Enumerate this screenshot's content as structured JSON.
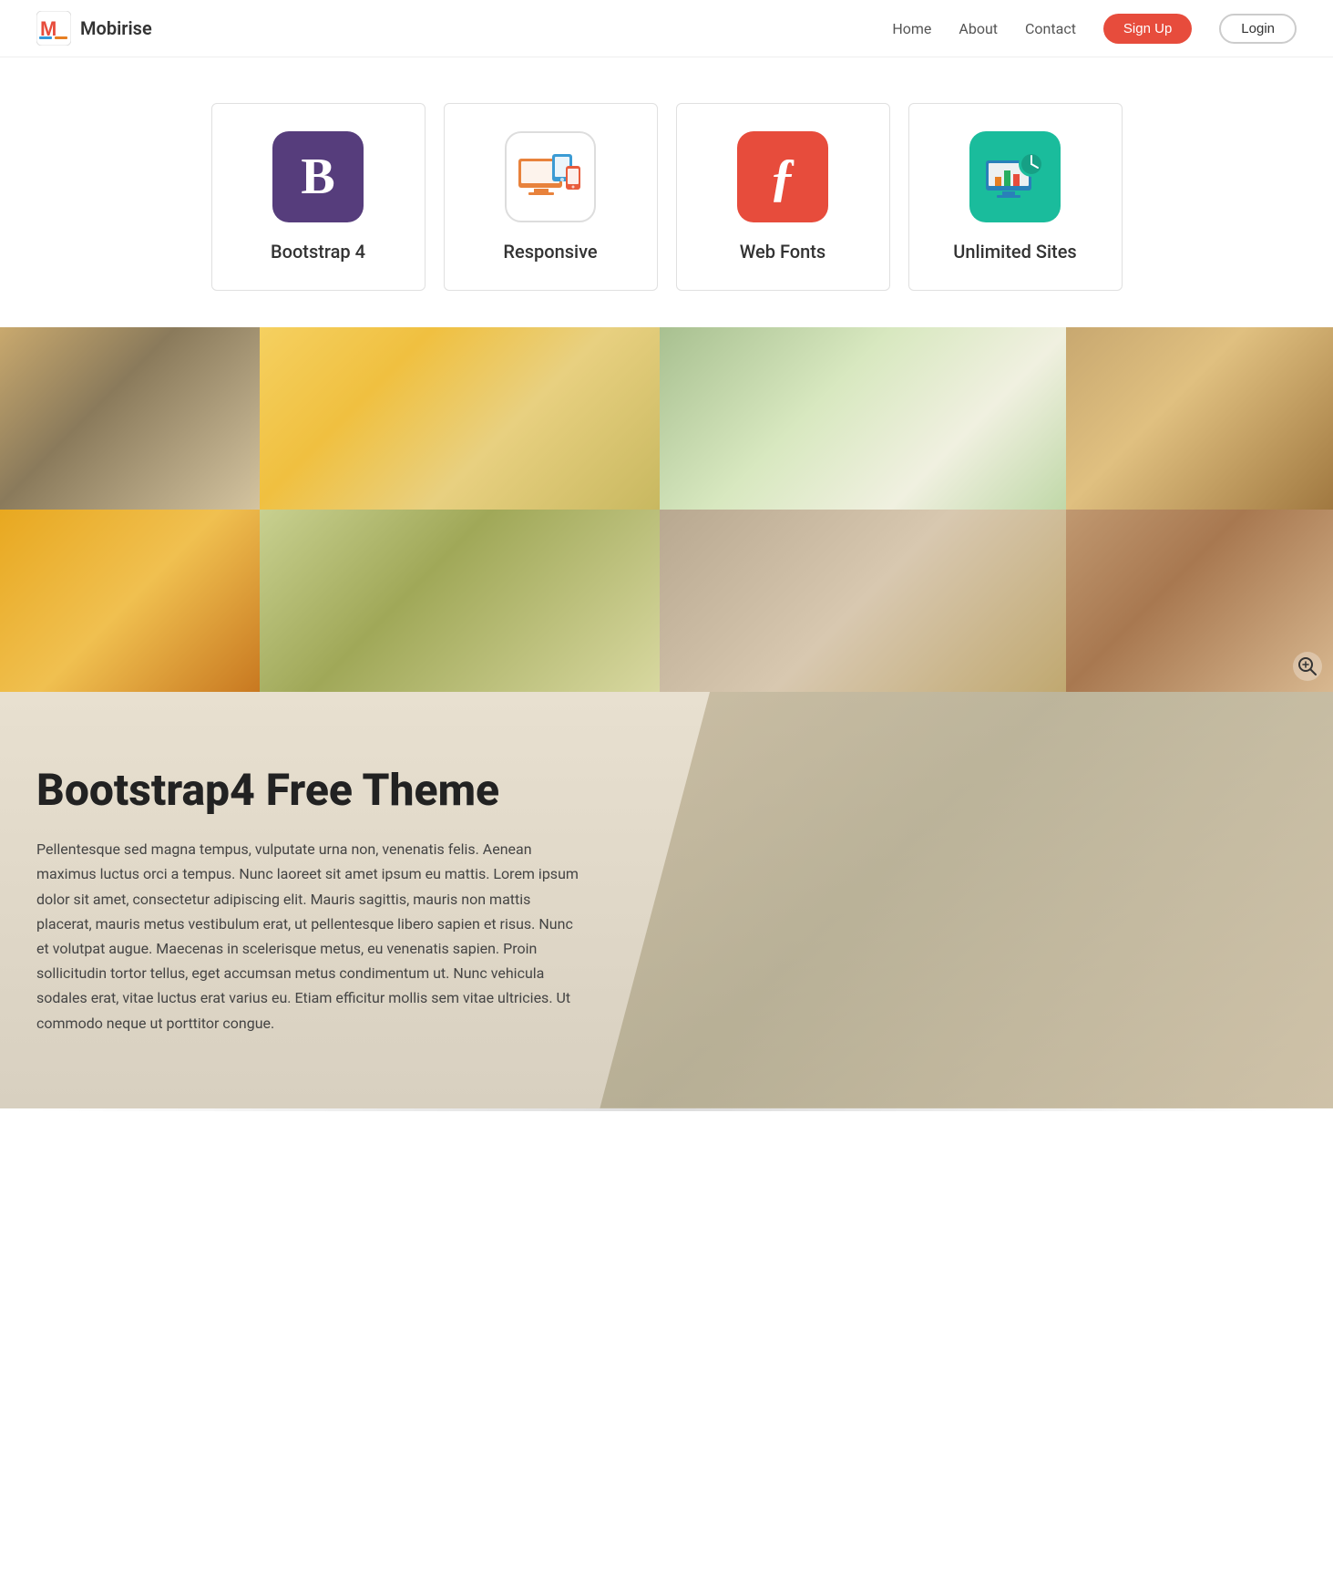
{
  "brand": {
    "name": "Mobirise"
  },
  "navbar": {
    "links": [
      {
        "id": "home",
        "label": "Home"
      },
      {
        "id": "about",
        "label": "About"
      },
      {
        "id": "contact",
        "label": "Contact"
      }
    ],
    "signup_label": "Sign Up",
    "login_label": "Login"
  },
  "features": [
    {
      "id": "bootstrap4",
      "title": "Bootstrap 4",
      "icon_type": "bootstrap"
    },
    {
      "id": "responsive",
      "title": "Responsive",
      "icon_type": "responsive"
    },
    {
      "id": "webfonts",
      "title": "Web Fonts",
      "icon_type": "fonts"
    },
    {
      "id": "unlimited",
      "title": "Unlimited Sites",
      "icon_type": "unlimited"
    }
  ],
  "content": {
    "title": "Bootstrap4 Free Theme",
    "body": "Pellentesque sed magna tempus, vulputate urna non, venenatis felis. Aenean maximus luctus orci a tempus. Nunc laoreet sit amet ipsum eu mattis. Lorem ipsum dolor sit amet, consectetur adipiscing elit. Mauris sagittis, mauris non mattis placerat, mauris metus vestibulum erat, ut pellentesque libero sapien et risus. Nunc et volutpat augue. Maecenas in scelerisque metus, eu venenatis sapien. Proin sollicitudin tortor tellus, eget accumsan metus condimentum ut. Nunc vehicula sodales erat, vitae luctus erat varius eu. Etiam efficitur mollis sem vitae ultricies. Ut commodo neque ut porttitor congue."
  },
  "zoom_icon": "⊕"
}
